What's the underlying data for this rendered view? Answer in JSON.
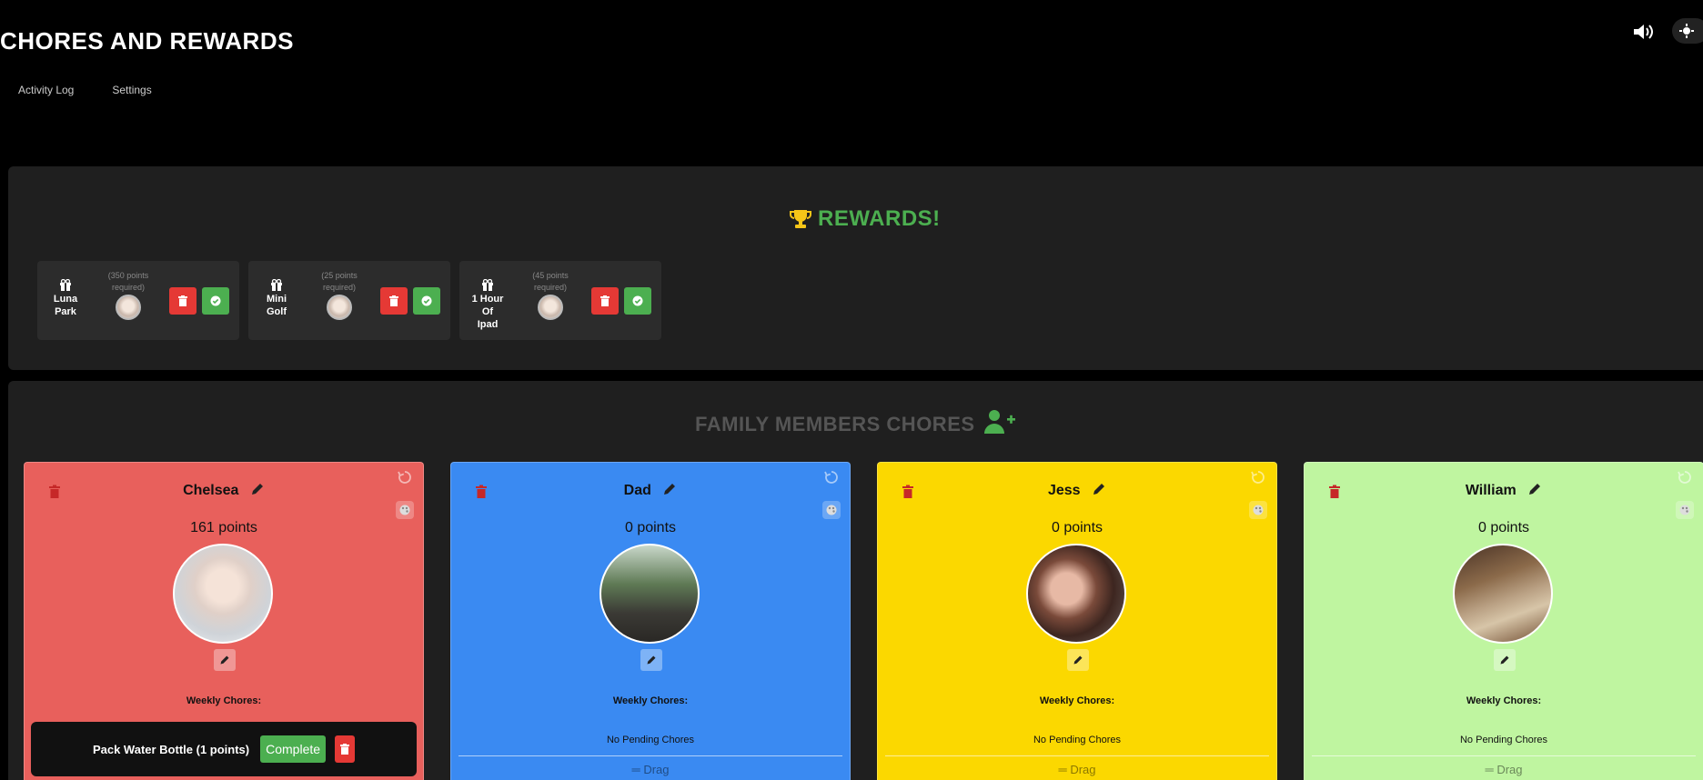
{
  "app": {
    "title": "CHORES AND REWARDS"
  },
  "nav": {
    "items": [
      "Activity Log",
      "Settings"
    ]
  },
  "header_icons": {
    "sound": "volume-icon",
    "theme": "sun-gear-icon"
  },
  "rewards": {
    "heading": "REWARDS!",
    "heading_color": "#4caf50",
    "trophy_color": "#f5c518",
    "items": [
      {
        "name_line1": "Luna",
        "name_line2": "Park",
        "points_line1": "(350 points",
        "points_line2": "required)"
      },
      {
        "name_line1": "Mini",
        "name_line2": "Golf",
        "points_line1": "(25 points",
        "points_line2": "required)"
      },
      {
        "name_line1": "1 Hour Of",
        "name_line2": "Ipad",
        "points_line1": "(45 points",
        "points_line2": "required)"
      }
    ]
  },
  "family": {
    "heading": "FAMILY MEMBERS CHORES",
    "members": [
      {
        "name": "Chelsea",
        "points": "161 points",
        "color": "#e8605c",
        "weekly": "Weekly Chores:",
        "chore": {
          "label": "Pack Water Bottle (1 points)",
          "complete": "Complete"
        }
      },
      {
        "name": "Dad",
        "points": "0 points",
        "color": "#3a8af2",
        "weekly": "Weekly Chores:",
        "no_pending": "No Pending Chores",
        "drag": "Drag"
      },
      {
        "name": "Jess",
        "points": "0 points",
        "color": "#fbd800",
        "weekly": "Weekly Chores:",
        "no_pending": "No Pending Chores",
        "drag": "Drag"
      },
      {
        "name": "William",
        "points": "0 points",
        "color": "#bff5a0",
        "weekly": "Weekly Chores:",
        "no_pending": "No Pending Chores",
        "drag": "Drag"
      }
    ]
  }
}
